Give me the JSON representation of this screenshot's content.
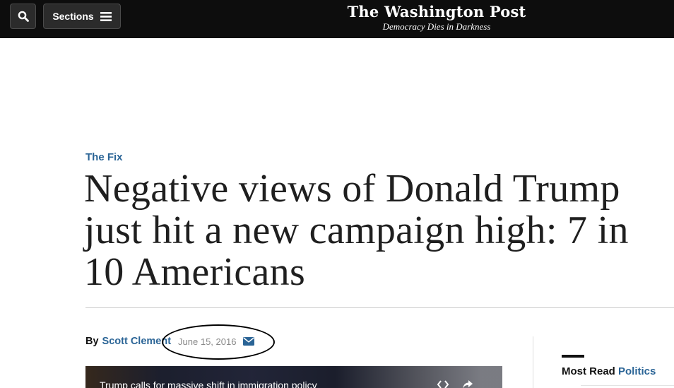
{
  "header": {
    "sections_label": "Sections",
    "logo_text": "The Washington Post",
    "tagline": "Democracy Dies in Darkness"
  },
  "article": {
    "kicker": "The Fix",
    "headline": "Negative views of Donald Trump just hit a new campaign high: 7 in 10 Americans",
    "byline_prefix": "By",
    "author": "Scott Clement",
    "date": "June 15, 2016"
  },
  "video": {
    "caption": "Trump calls for massive shift in immigration policy"
  },
  "sidebar": {
    "most_read_label": "Most Read",
    "most_read_section": "Politics"
  },
  "icons": {
    "search": "search-icon",
    "menu": "hamburger-icon",
    "email": "envelope-icon",
    "embed": "embed-icon",
    "share": "share-icon"
  },
  "colors": {
    "header_bg": "#0d0d0d",
    "link_blue": "#2a6496",
    "headline": "#1f1f1f"
  }
}
